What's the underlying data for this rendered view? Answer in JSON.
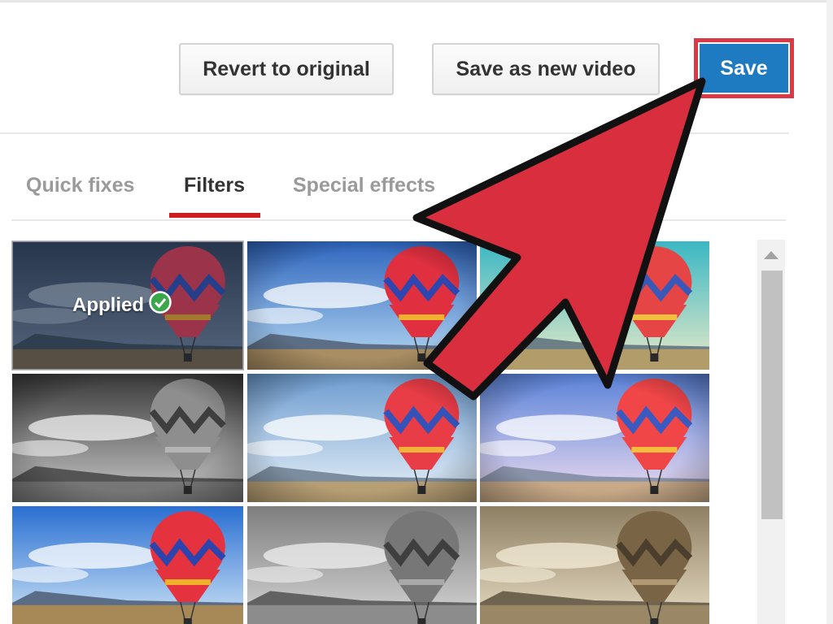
{
  "toolbar": {
    "revert_label": "Revert to original",
    "save_new_label": "Save as new video",
    "save_label": "Save"
  },
  "tabs": [
    {
      "label": "Quick fixes",
      "active": false
    },
    {
      "label": "Filters",
      "active": true
    },
    {
      "label": "Special effects",
      "active": false
    }
  ],
  "filters": {
    "applied_label": "Applied",
    "applied_icon": "check-circle-icon",
    "tiles": [
      {
        "style": "dark-cool",
        "applied": true
      },
      {
        "style": "vivid-vignette",
        "applied": false
      },
      {
        "style": "warm-cyan",
        "applied": false
      },
      {
        "style": "black-white-vignette",
        "applied": false
      },
      {
        "style": "bright-vignette",
        "applied": false
      },
      {
        "style": "lavender-glow",
        "applied": false
      },
      {
        "style": "vivid",
        "applied": false
      },
      {
        "style": "grayscale",
        "applied": false
      },
      {
        "style": "sepia",
        "applied": false
      }
    ]
  },
  "colors": {
    "save_button": "#1f7bc1",
    "highlight": "#d93a48",
    "tab_underline": "#cc1e1e",
    "arrow_fill": "#d92e3e"
  },
  "annotation": {
    "icon": "pointer-arrow-icon"
  }
}
